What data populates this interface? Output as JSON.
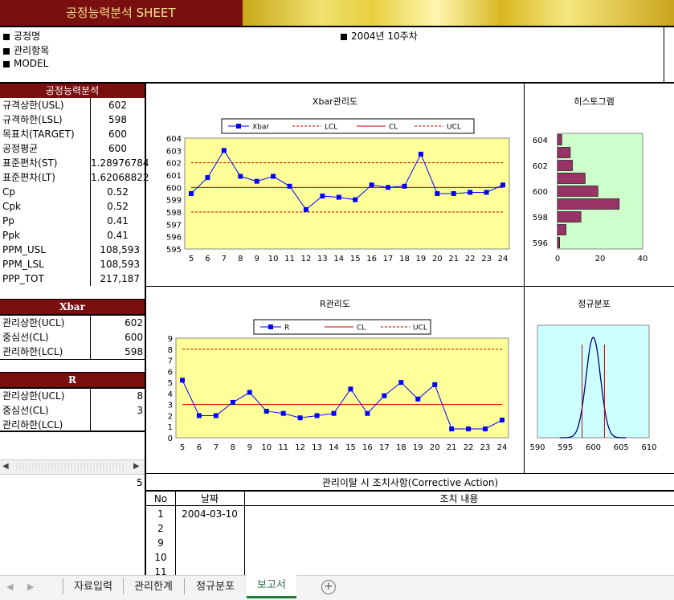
{
  "header": {
    "title": "공정능력분석  SHEET"
  },
  "info": {
    "process": "공정명",
    "item": "관리항목",
    "model": "MODEL",
    "week": "2004년 10주차"
  },
  "capability": {
    "title": "공정능력분석",
    "rows": [
      {
        "label": "규격상한(USL)",
        "value": "602"
      },
      {
        "label": "규격하한(LSL)",
        "value": "598"
      },
      {
        "label": "목표치(TARGET)",
        "value": "600"
      },
      {
        "label": "공정평균",
        "value": "600"
      },
      {
        "label": "표준편차(ST)",
        "value": "1.28976784"
      },
      {
        "label": "표준편차(LT)",
        "value": "1.62068822"
      },
      {
        "label": "Cp",
        "value": "0.52"
      },
      {
        "label": "Cpk",
        "value": "0.52"
      },
      {
        "label": "Pp",
        "value": "0.41"
      },
      {
        "label": "Ppk",
        "value": "0.41"
      },
      {
        "label": "PPM_USL",
        "value": "108,593"
      },
      {
        "label": "PPM_LSL",
        "value": "108,593"
      },
      {
        "label": "PPP_TOT",
        "value": "217,187"
      }
    ]
  },
  "xbar_limits": {
    "title": "Xbar",
    "rows": [
      {
        "label": "관리상한(UCL)",
        "value": "602"
      },
      {
        "label": "중심선(CL)",
        "value": "600"
      },
      {
        "label": "관리하한(LCL)",
        "value": "598"
      }
    ]
  },
  "r_limits": {
    "title": "R",
    "rows": [
      {
        "label": "관리상한(UCL)",
        "value": "8"
      },
      {
        "label": "중심선(CL)",
        "value": "3"
      },
      {
        "label": "관리하한(LCL)",
        "value": ""
      }
    ]
  },
  "stray_value": "5",
  "colors": {
    "header_bg": "#7a0f0f",
    "plot_yellow": "#ffff99",
    "hist_bg": "#ccffcc",
    "normal_bg": "#ccffff",
    "series_blue": "#0000ff",
    "limit_red": "#cc0000",
    "bar_fill": "#993366"
  },
  "chart_data": [
    {
      "type": "line",
      "title": "Xbar관리도",
      "x": [
        5,
        6,
        7,
        8,
        9,
        10,
        11,
        12,
        13,
        14,
        15,
        16,
        17,
        18,
        19,
        20,
        21,
        22,
        23,
        24
      ],
      "series": [
        {
          "name": "Xbar",
          "values": [
            599.5,
            600.8,
            603.0,
            600.9,
            600.5,
            600.9,
            600.1,
            598.2,
            599.3,
            599.2,
            599.0,
            600.2,
            600.0,
            600.1,
            602.7,
            599.5,
            599.5,
            599.6,
            599.6,
            600.2
          ]
        },
        {
          "name": "LCL",
          "values": [
            598,
            598,
            598,
            598,
            598,
            598,
            598,
            598,
            598,
            598,
            598,
            598,
            598,
            598,
            598,
            598,
            598,
            598,
            598,
            598
          ]
        },
        {
          "name": "CL",
          "values": [
            600,
            600,
            600,
            600,
            600,
            600,
            600,
            600,
            600,
            600,
            600,
            600,
            600,
            600,
            600,
            600,
            600,
            600,
            600,
            600
          ]
        },
        {
          "name": "UCL",
          "values": [
            602,
            602,
            602,
            602,
            602,
            602,
            602,
            602,
            602,
            602,
            602,
            602,
            602,
            602,
            602,
            602,
            602,
            602,
            602,
            602
          ]
        }
      ],
      "yticks": [
        595,
        596,
        597,
        598,
        599,
        600,
        601,
        602,
        603,
        604
      ],
      "ylim": [
        595,
        604
      ]
    },
    {
      "type": "bar",
      "title": "히스토그램",
      "orientation": "horizontal",
      "categories": [
        596,
        597,
        598,
        599,
        600,
        601,
        602,
        603,
        604
      ],
      "values": [
        1,
        4,
        11,
        29,
        19,
        13,
        7,
        6,
        2
      ],
      "yticks": [
        596,
        598,
        600,
        602,
        604
      ],
      "xticks": [
        0,
        20,
        40
      ],
      "xlim": [
        0,
        40
      ]
    },
    {
      "type": "line",
      "title": "R관리도",
      "x": [
        5,
        6,
        7,
        8,
        9,
        10,
        11,
        12,
        13,
        14,
        15,
        16,
        17,
        18,
        19,
        20,
        21,
        22,
        23,
        24
      ],
      "series": [
        {
          "name": "R",
          "values": [
            5.2,
            2.0,
            2.0,
            3.2,
            4.1,
            2.4,
            2.2,
            1.8,
            2.0,
            2.2,
            4.4,
            2.2,
            3.8,
            5.0,
            3.5,
            4.8,
            0.8,
            0.8,
            0.8,
            1.6
          ]
        },
        {
          "name": "CL",
          "values": [
            3,
            3,
            3,
            3,
            3,
            3,
            3,
            3,
            3,
            3,
            3,
            3,
            3,
            3,
            3,
            3,
            3,
            3,
            3,
            3
          ]
        },
        {
          "name": "UCL",
          "values": [
            8,
            8,
            8,
            8,
            8,
            8,
            8,
            8,
            8,
            8,
            8,
            8,
            8,
            8,
            8,
            8,
            8,
            8,
            8,
            8
          ]
        }
      ],
      "yticks": [
        0,
        1,
        2,
        3,
        4,
        5,
        6,
        7,
        8,
        9
      ],
      "ylim": [
        0,
        9
      ]
    },
    {
      "type": "line",
      "title": "정규분포",
      "distribution": {
        "mean": 600,
        "sd": 1.29,
        "lsl": 598,
        "usl": 602
      },
      "xticks": [
        590,
        595,
        600,
        605,
        610
      ],
      "xlim": [
        590,
        610
      ]
    }
  ],
  "corrective": {
    "title": "관리이탈 시 조치사항(Corrective Action)",
    "headers": [
      "No",
      "날짜",
      "조치 내용"
    ],
    "rows": [
      {
        "no": "1",
        "date": "2004-03-10"
      },
      {
        "no": "2",
        "date": ""
      },
      {
        "no": "9",
        "date": ""
      },
      {
        "no": "10",
        "date": ""
      },
      {
        "no": "11",
        "date": ""
      }
    ]
  },
  "tabs": [
    {
      "label": "자료입력"
    },
    {
      "label": "관리한계"
    },
    {
      "label": "정규분포"
    },
    {
      "label": "보고서"
    }
  ]
}
